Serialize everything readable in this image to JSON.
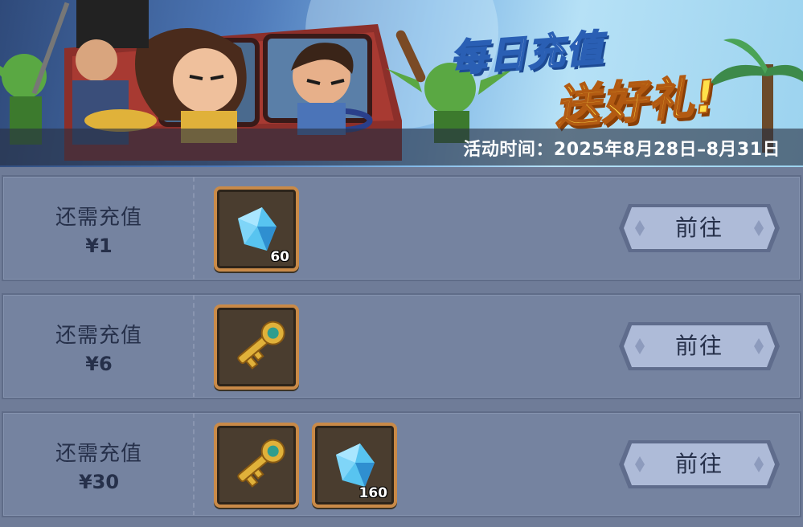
{
  "banner": {
    "title_line1": "每日充值",
    "title_line2": "送好礼!",
    "time_label": "活动时间：",
    "time_range": "2025年8月28日–8月31日"
  },
  "tiers": [
    {
      "label": "还需充值",
      "amount": "¥1",
      "rewards": [
        {
          "icon": "diamond-icon",
          "quantity": "60"
        }
      ],
      "button": "前往"
    },
    {
      "label": "还需充值",
      "amount": "¥6",
      "rewards": [
        {
          "icon": "key-icon",
          "quantity": ""
        }
      ],
      "button": "前往"
    },
    {
      "label": "还需充值",
      "amount": "¥30",
      "rewards": [
        {
          "icon": "key-icon",
          "quantity": ""
        },
        {
          "icon": "diamond-icon",
          "quantity": "160"
        }
      ],
      "button": "前往"
    }
  ],
  "colors": {
    "panel_bg": "#6f7c98",
    "row_bg": "#7583a0",
    "item_frame": "#c98a48",
    "item_bg": "#4a3d2f",
    "button_fill": "#aebbd8",
    "text_dark": "#26304a",
    "title_yellow": "#ffe14a"
  }
}
